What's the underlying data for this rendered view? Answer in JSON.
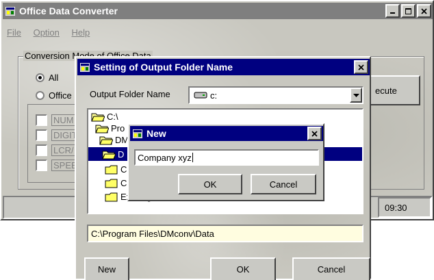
{
  "main_window": {
    "title": "Office Data Converter",
    "menu": {
      "file": "File",
      "option": "Option",
      "help": "Help"
    },
    "conversion_group_label": "Conversion Mode of Office Data",
    "radio_all": "All",
    "radio_office": "Office",
    "checkboxes": [
      "NUM",
      "DIGIT",
      "LCR/",
      "SPEE"
    ],
    "execute_label": "ecute",
    "status_time": "09:30"
  },
  "folder_dialog": {
    "title": "Setting of Output Folder Name",
    "output_folder_label": "Output Folder Name",
    "drive_value": "c:",
    "tree": [
      {
        "label": "C:\\",
        "selected": false
      },
      {
        "label": "Pro",
        "selected": false
      },
      {
        "label": "DM",
        "selected": false
      },
      {
        "label": "D",
        "selected": true
      },
      {
        "label": "C",
        "selected": false
      },
      {
        "label": "C",
        "selected": false
      },
      {
        "label": "Existing",
        "selected": false
      }
    ],
    "path_value": "C:\\Program Files\\DMconv\\Data",
    "new_label": "New",
    "ok_label": "OK",
    "cancel_label": "Cancel"
  },
  "new_dialog": {
    "title": "New",
    "input_value": "Company xyz",
    "ok_label": "OK",
    "cancel_label": "Cancel"
  },
  "icons": {
    "app": "app-window-icon",
    "close": "close-icon",
    "minimize": "minimize-icon",
    "maximize": "maximize-icon",
    "drive": "drive-icon",
    "dropdown": "chevron-down-icon",
    "folder": "folder-icon"
  },
  "colors": {
    "active_title": "#000080",
    "inactive_title": "#7f7f7f",
    "face": "#c9c9c4",
    "selection": "#000080",
    "path_background": "#fffde0"
  }
}
